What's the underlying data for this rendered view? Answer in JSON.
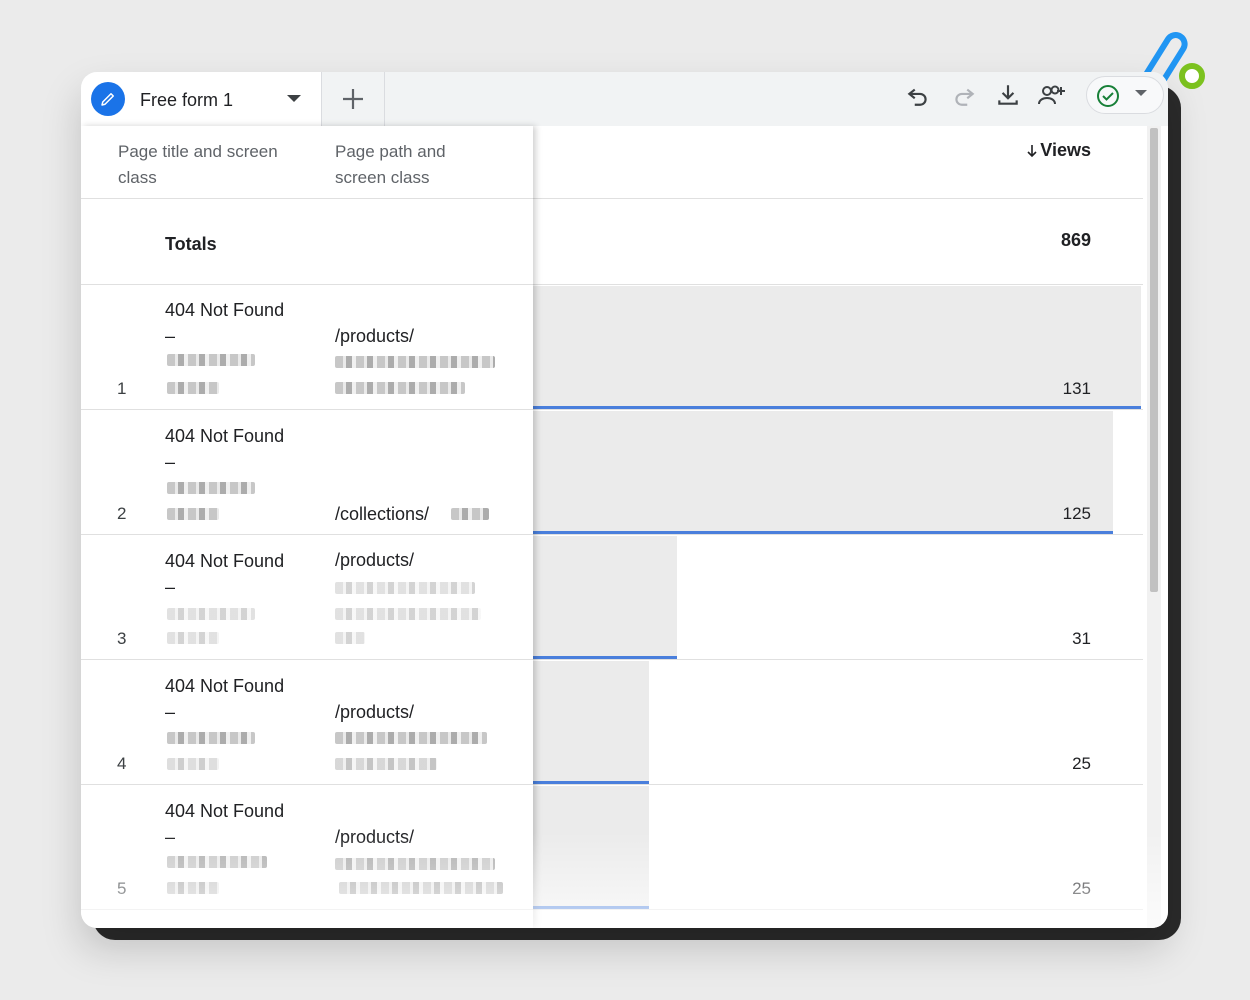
{
  "tab": {
    "label": "Free form 1"
  },
  "toolbar": {
    "icons": [
      "undo-icon",
      "redo-icon",
      "download-icon",
      "share-icon",
      "check-circle-icon"
    ]
  },
  "table": {
    "col1_header": "Page title and screen class",
    "col2_header": "Page path and screen class",
    "views_header": "Views",
    "totals_label": "Totals",
    "totals_value": "869",
    "rows": [
      {
        "index": "1",
        "title": "404 Not Found",
        "dash": "–",
        "path": "/products/",
        "views": "131",
        "fraction": 1.0
      },
      {
        "index": "2",
        "title": "404 Not Found",
        "dash": "–",
        "path": "/collections/",
        "views": "125",
        "fraction": 0.954
      },
      {
        "index": "3",
        "title": "404 Not Found",
        "dash": "–",
        "path": "/products/",
        "views": "31",
        "fraction": 0.237
      },
      {
        "index": "4",
        "title": "404 Not Found",
        "dash": "–",
        "path": "/products/",
        "views": "25",
        "fraction": 0.191
      },
      {
        "index": "5",
        "title": "404 Not Found",
        "dash": "–",
        "path": "/products/",
        "views": "25",
        "fraction": 0.191
      }
    ]
  },
  "colors": {
    "accent": "#1a73e8",
    "bar_line": "#4a7fdc",
    "bar_fill": "#ebebeb",
    "check": "#188038"
  }
}
